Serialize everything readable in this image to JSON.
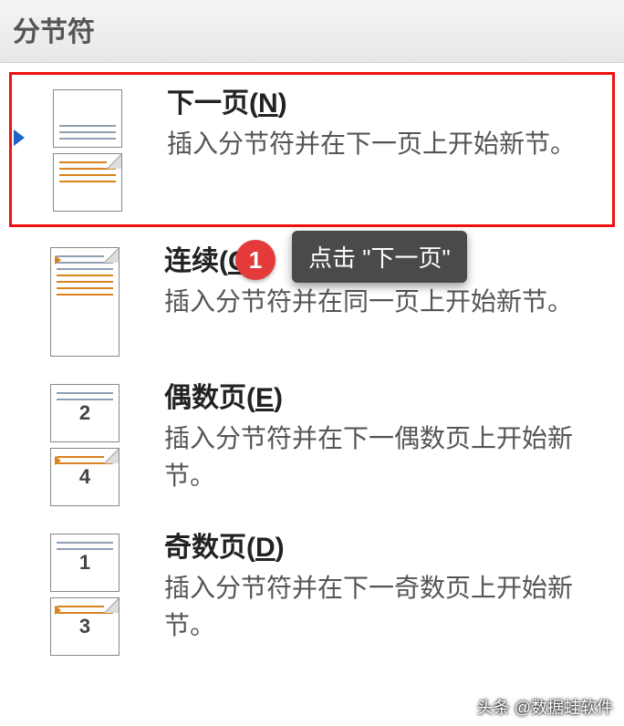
{
  "header": {
    "title": "分节符"
  },
  "items": [
    {
      "title_pre": "下一页(",
      "hotkey": "N",
      "title_post": ")",
      "desc": "插入分节符并在下一页上开始新节。",
      "highlight": true
    },
    {
      "title_pre": "连续(",
      "hotkey": "O",
      "title_post": ")",
      "desc": "插入分节符并在同一页上开始新节。"
    },
    {
      "title_pre": "偶数页(",
      "hotkey": "E",
      "title_post": ")",
      "desc": "插入分节符并在下一偶数页上开始新节。",
      "num_top": "2",
      "num_bottom": "4"
    },
    {
      "title_pre": "奇数页(",
      "hotkey": "D",
      "title_post": ")",
      "desc": "插入分节符并在下一奇数页上开始新节。",
      "num_top": "1",
      "num_bottom": "3"
    }
  ],
  "annotation": {
    "badge": "1",
    "tooltip": "点击 \"下一页\""
  },
  "watermark": "头条 @数据蛙软件"
}
